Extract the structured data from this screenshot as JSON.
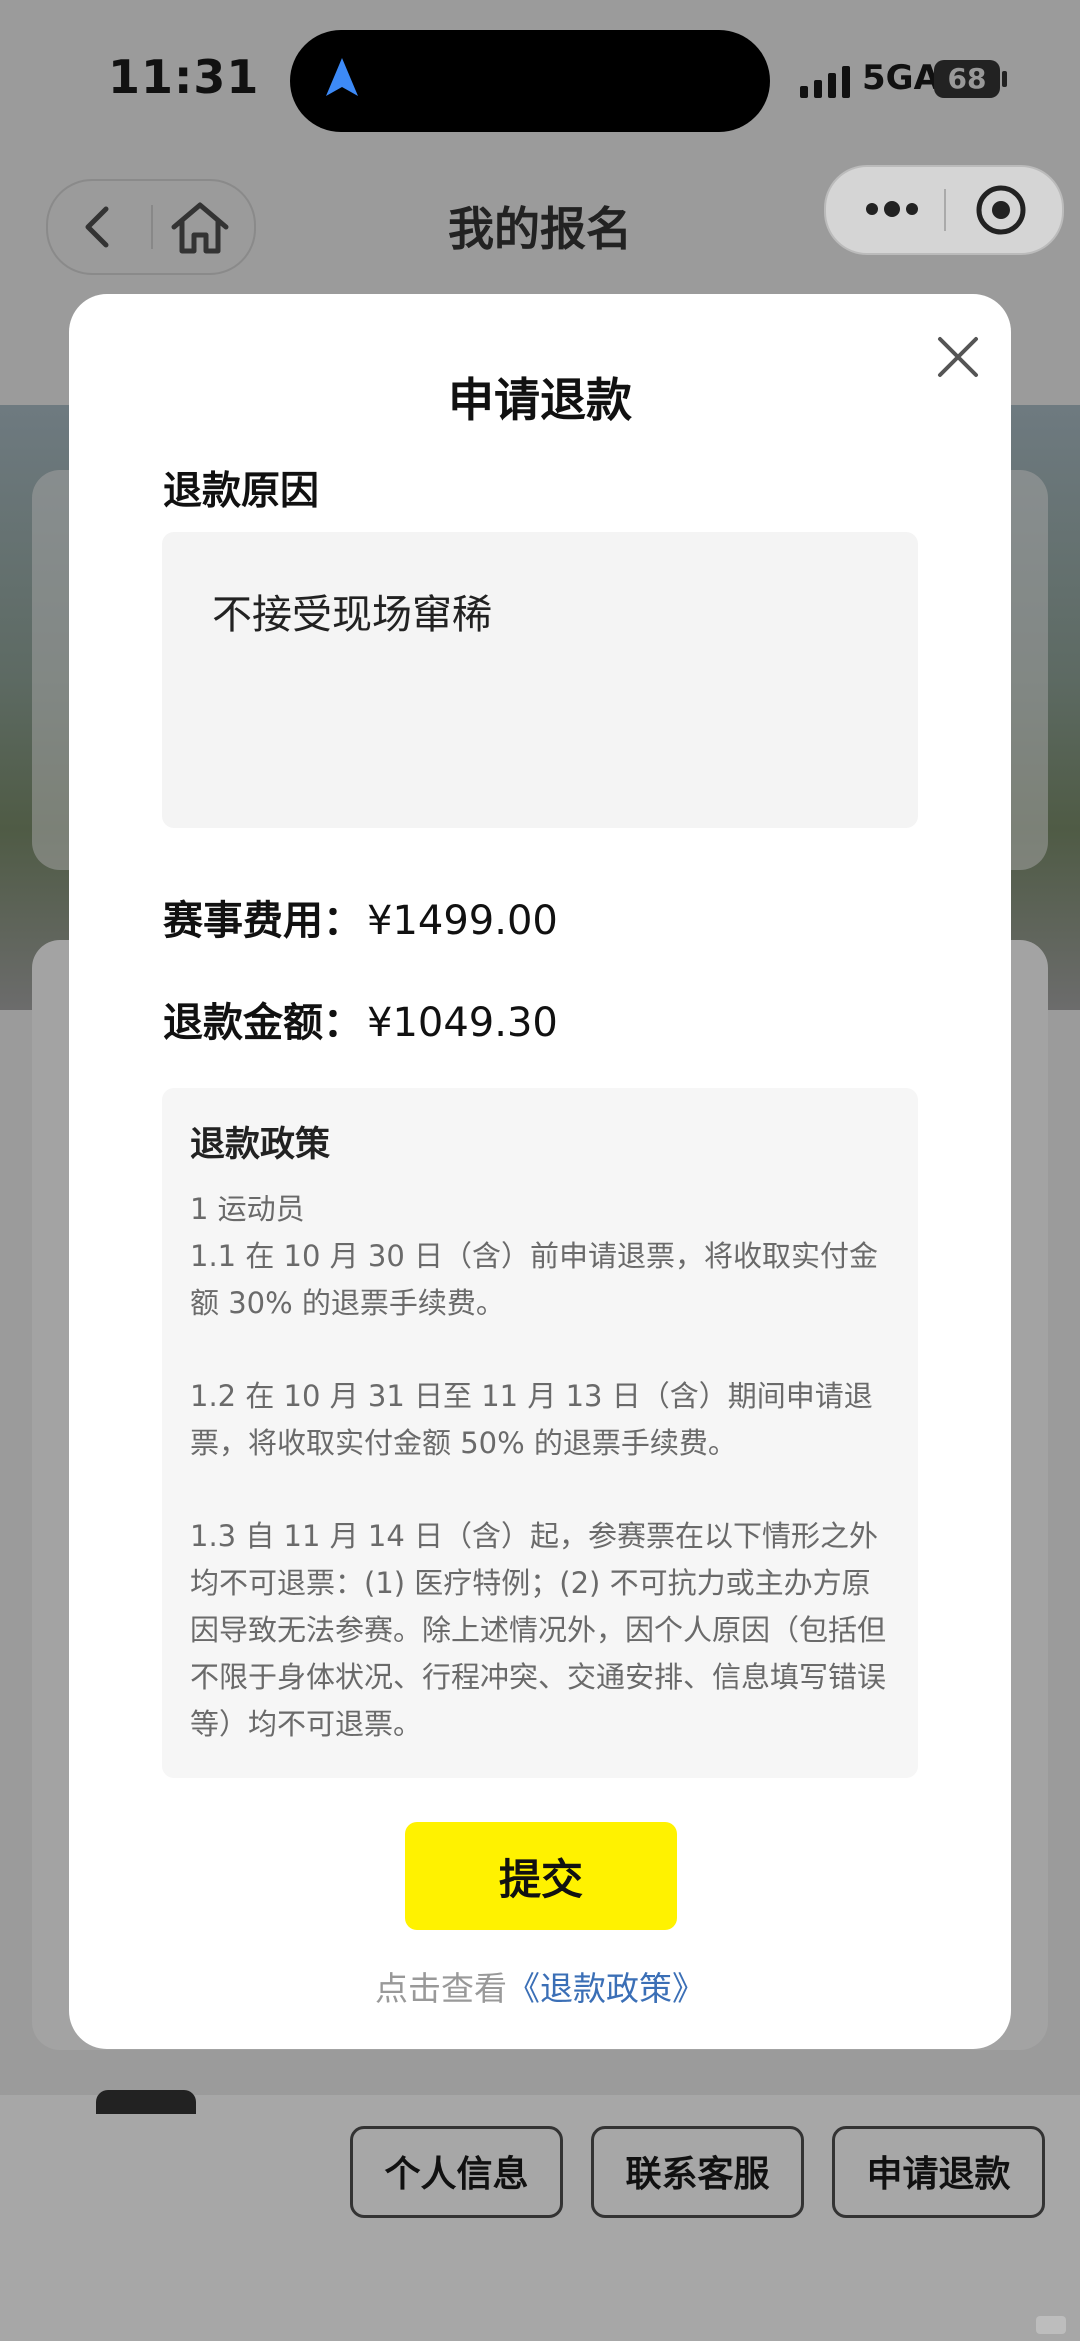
{
  "status_bar": {
    "time": "11:31",
    "network": "5GA",
    "battery": "68"
  },
  "nav": {
    "title": "我的报名"
  },
  "background_actions": [
    {
      "label": "个人信息"
    },
    {
      "label": "联系客服"
    },
    {
      "label": "申请退款"
    }
  ],
  "modal": {
    "title": "申请退款",
    "reason_label": "退款原因",
    "reason_text": "不接受现场窜稀",
    "fee_label": "赛事费用：",
    "fee_value": "¥1499.00",
    "refund_label": "退款金额：",
    "refund_value": "¥1049.30",
    "policy": {
      "title": "退款政策",
      "section": "1 运动员",
      "rule_1_1": "1.1 在 10 月 30 日（含）前申请退票，将收取实付金额 30% 的退票手续费。",
      "rule_1_2": "1.2 在 10 月 31 日至 11 月 13 日（含）期间申请退票，将收取实付金额 50% 的退票手续费。",
      "rule_1_3": "1.3 自 11 月 14 日（含）起，参赛票在以下情形之外均不可退票：(1) 医疗特例；(2) 不可抗力或主办方原因导致无法参赛。除上述情况外，因个人原因（包括但不限于身体状况、行程冲突、交通安排、信息填写错误等）均不可退票。"
    },
    "submit_label": "提交",
    "view_prefix": "点击查看",
    "view_link": "《退款政策》"
  },
  "colors": {
    "submit_yellow": "#fff200",
    "link_blue": "#3b6fb6"
  },
  "icons": [
    "navigation-arrow-icon",
    "signal-icon",
    "back-icon",
    "home-icon",
    "more-dots-icon",
    "target-icon",
    "close-icon"
  ]
}
